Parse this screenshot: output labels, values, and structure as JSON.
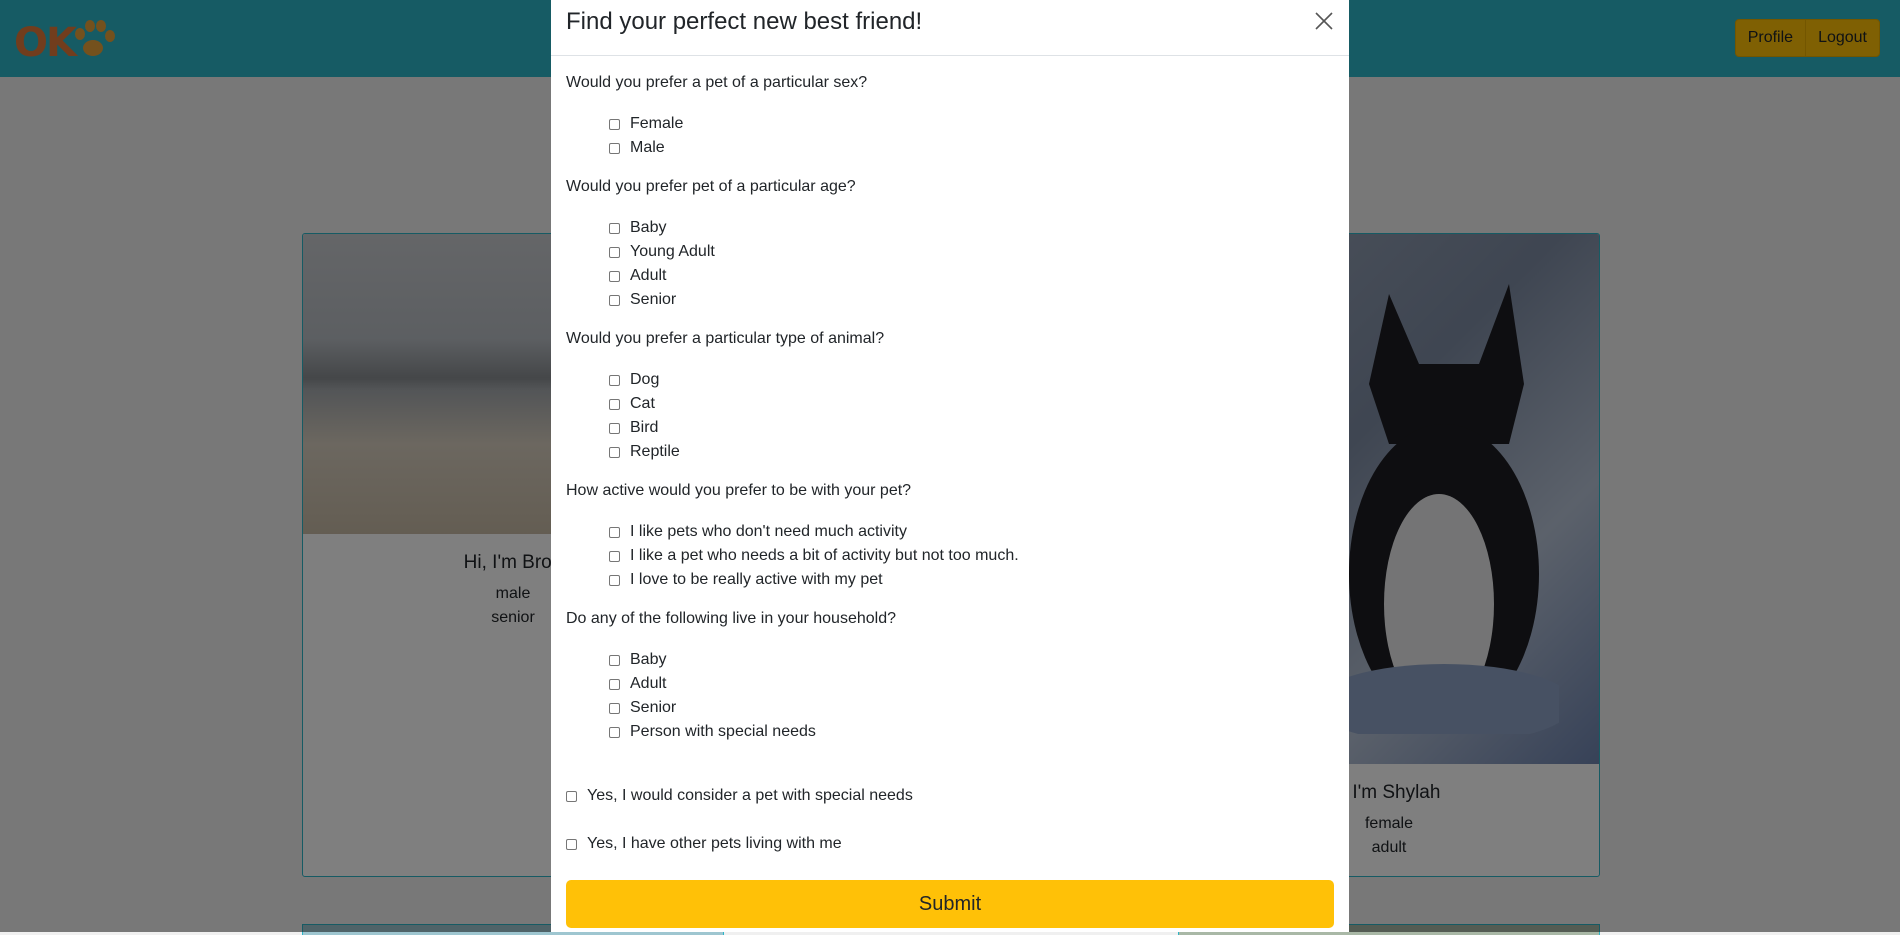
{
  "nav": {
    "logo_text": "OK",
    "profile_label": "Profile",
    "logout_label": "Logout"
  },
  "cards": [
    {
      "name": "Hi, I'm Brod",
      "sex": "male",
      "age": "senior"
    },
    {
      "name": "i, I'm Shylah",
      "sex": "female",
      "age": "adult"
    }
  ],
  "modal": {
    "title": "Find your perfect new best friend!",
    "questions": [
      {
        "label": "Would you prefer a pet of a particular sex?",
        "options": [
          "Female",
          "Male"
        ]
      },
      {
        "label": "Would you prefer pet of a particular age?",
        "options": [
          "Baby",
          "Young Adult",
          "Adult",
          "Senior"
        ]
      },
      {
        "label": "Would you prefer a particular type of animal?",
        "options": [
          "Dog",
          "Cat",
          "Bird",
          "Reptile"
        ]
      },
      {
        "label": "How active would you prefer to be with your pet?",
        "options": [
          "I like pets who don't need much activity",
          "I like a pet who needs a bit of activity but not too much.",
          "I love to be really active with my pet"
        ]
      },
      {
        "label": "Do any of the following live in your household?",
        "options": [
          "Baby",
          "Adult",
          "Senior",
          "Person with special needs"
        ]
      }
    ],
    "special_needs_label": "Yes, I would consider a pet with special needs",
    "other_pets_label": "Yes, I have other pets living with me",
    "submit_label": "Submit"
  },
  "colors": {
    "navbar": "#2db6c9",
    "accent": "#ffc107",
    "logo": "#e27b3a"
  }
}
